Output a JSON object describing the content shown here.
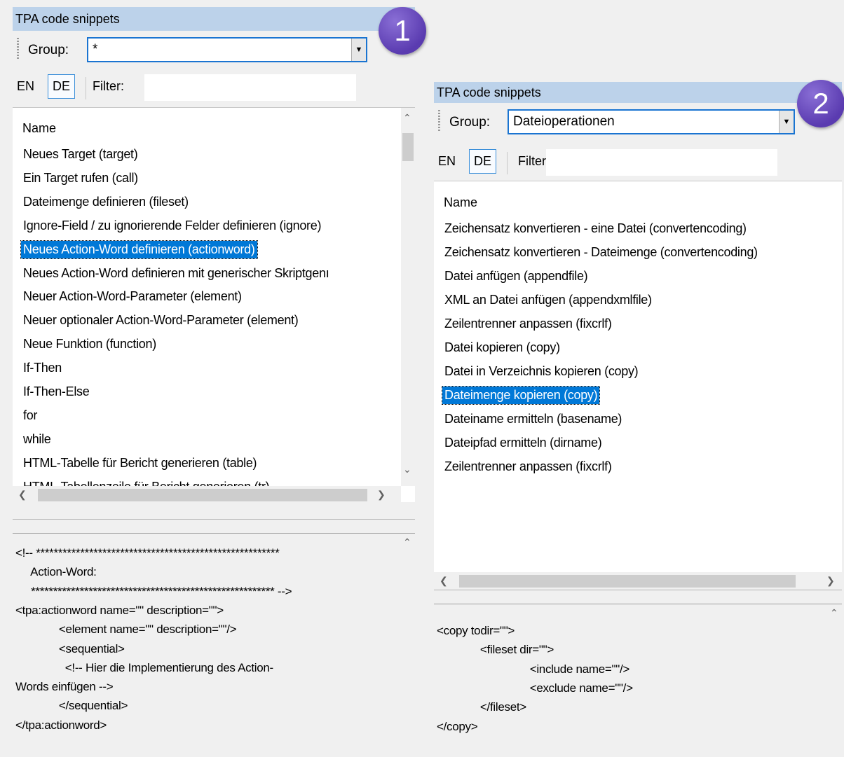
{
  "panel1": {
    "badge": "1",
    "title": "TPA code snippets",
    "group_label": "Group:",
    "group_value": "*",
    "lang_en": "EN",
    "lang_de": "DE",
    "filter_label": "Filter:",
    "list_header": "Name",
    "items": [
      "Neues Target (target)",
      "Ein Target rufen (call)",
      "Dateimenge definieren (fileset)",
      "Ignore-Field / zu ignorierende Felder definieren (ignore)",
      "Neues Action-Word definieren (actionword)",
      "Neues Action-Word definieren mit generischer Skriptgenı",
      "Neuer Action-Word-Parameter (element)",
      "Neuer optionaler Action-Word-Parameter (element)",
      "Neue Funktion (function)",
      "If-Then",
      "If-Then-Else",
      "for",
      "while",
      "HTML-Tabelle für Bericht generieren (table)",
      "HTML-Tabellenzeile für Bericht generieren (tr)"
    ],
    "selected_index": 4,
    "code_lines": [
      "<!-- *******************************************************",
      "     Action-Word:",
      "     ******************************************************* -->",
      "<tpa:actionword name=\"\" description=\"\">",
      "              <element name=\"\" description=\"\"/>",
      "              <sequential>",
      "                <!-- Hier die Implementierung des Action-",
      "Words einfügen -->",
      "              </sequential>",
      "</tpa:actionword>"
    ]
  },
  "panel2": {
    "badge": "2",
    "title": "TPA code snippets",
    "group_label": "Group:",
    "group_value": "Dateioperationen",
    "lang_en": "EN",
    "lang_de": "DE",
    "filter_label": "Filter:",
    "list_header": "Name",
    "items": [
      "Zeichensatz konvertieren - eine Datei (convertencoding)",
      "Zeichensatz konvertieren - Dateimenge (convertencoding)",
      "Datei anfügen (appendfile)",
      "XML an Datei anfügen (appendxmlfile)",
      "Zeilentrenner anpassen (fixcrlf)",
      "Datei kopieren (copy)",
      "Datei in Verzeichnis kopieren (copy)",
      "Dateimenge kopieren (copy)",
      "Dateiname ermitteln (basename)",
      "Dateipfad ermitteln (dirname)",
      "Zeilentrenner anpassen (fixcrlf)"
    ],
    "selected_index": 7,
    "code_lines": [
      "<copy todir=\"\">",
      "              <fileset dir=\"\">",
      "                              <include name=\"\"/>",
      "                              <exclude name=\"\"/>",
      "              </fileset>",
      "</copy>"
    ]
  },
  "icons": {
    "combo_arrow": "chevron-down-icon",
    "scroll_up": "scroll-up-icon",
    "scroll_down": "scroll-down-icon",
    "scroll_left": "scroll-left-icon",
    "scroll_right": "scroll-right-icon"
  },
  "colors": {
    "title_bar": "#bcd2ea",
    "selection": "#0078d7",
    "badge": "#6a4cc0",
    "combo_border": "#1a74d1"
  }
}
